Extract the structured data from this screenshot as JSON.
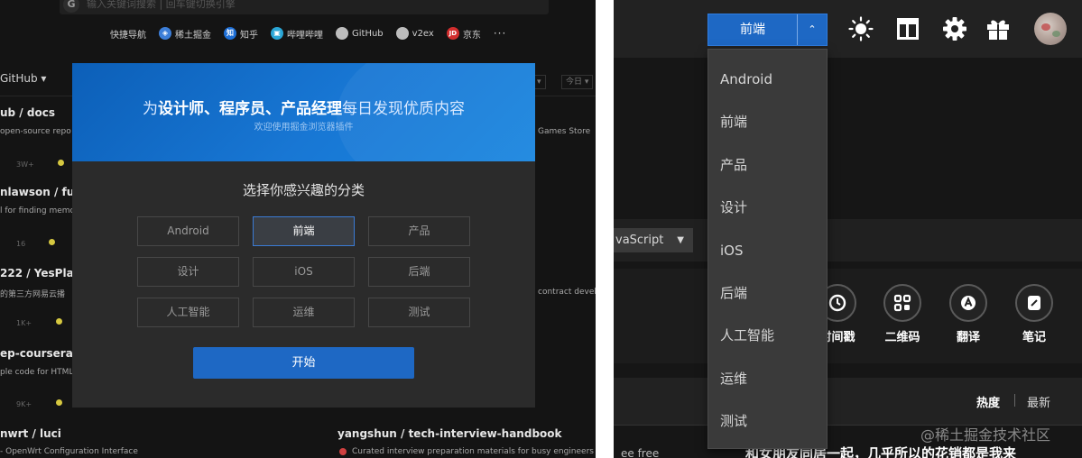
{
  "left": {
    "search_placeholder": "输入关键词搜索 | 回车键切换引擎",
    "quicknav": {
      "label": "快捷导航",
      "items": [
        {
          "label": "稀土掘金",
          "icon": "juejin-icon",
          "color": "#3c7ed8",
          "glyph": "◈"
        },
        {
          "label": "知乎",
          "icon": "zhihu-icon",
          "color": "#1e6fd6",
          "glyph": "知"
        },
        {
          "label": "哔哩哔哩",
          "icon": "bilibili-icon",
          "color": "#2aa6d6",
          "glyph": "▣"
        },
        {
          "label": "GitHub",
          "icon": "github-icon",
          "color": "#bdbdbd",
          "glyph": ""
        },
        {
          "label": "v2ex",
          "icon": "v2ex-icon",
          "color": "#bdbdbd",
          "glyph": ""
        },
        {
          "label": "京东",
          "icon": "jd-icon",
          "color": "#d22d2d",
          "glyph": "JD"
        }
      ],
      "more": "···"
    },
    "background": {
      "source_label": "GitHub ▾",
      "filter_today": "今日 ▾",
      "repos": [
        {
          "title": "ub / docs",
          "desc": "open-source repo for",
          "meta": "3W+"
        },
        {
          "title": "nlawson / fuite",
          "desc": "l for finding memory",
          "meta": "16"
        },
        {
          "title": "222 / YesPlayM",
          "desc": "的第三方网易云播",
          "meta": "1K+"
        },
        {
          "title": "ep-coursera / fu",
          "desc": "ple code for HTML",
          "meta": "9K+"
        }
      ],
      "right_snippets": [
        "Games Store",
        "contract develo"
      ],
      "bottom_left_title": "nwrt / luci",
      "bottom_left_desc": "- OpenWrt Configuration Interface",
      "bottom_right_title": "yangshun / tech-interview-handbook",
      "bottom_right_desc": "Curated interview preparation materials for busy engineers"
    },
    "modal": {
      "banner_prefix": "为",
      "banner_bold": "设计师、程序员、产品经理",
      "banner_suffix": "每日发现优质内容",
      "banner_sub": "欢迎使用掘金浏览器插件",
      "heading": "选择你感兴趣的分类",
      "categories": [
        "Android",
        "前端",
        "产品",
        "设计",
        "iOS",
        "后端",
        "人工智能",
        "运维",
        "测试"
      ],
      "selected": "前端",
      "start_label": "开始"
    }
  },
  "right": {
    "category_selected": "前端",
    "dropdown_arrow": "⌃",
    "dropdown_items": [
      "Android",
      "前端",
      "产品",
      "设计",
      "iOS",
      "后端",
      "人工智能",
      "运维",
      "测试"
    ],
    "lang_select": "vaScript",
    "tools": [
      {
        "label": "时间戳",
        "icon": "clock-icon"
      },
      {
        "label": "二维码",
        "icon": "qrcode-icon"
      },
      {
        "label": "翻译",
        "icon": "translate-icon"
      },
      {
        "label": "笔记",
        "icon": "note-icon"
      }
    ],
    "sort_hot": "热度",
    "sort_new": "最新",
    "feed_text": "和女朋友同居一起，几乎所以的花销都是我来",
    "feed_left": "ee free"
  },
  "watermark": "@稀土掘金技术社区"
}
